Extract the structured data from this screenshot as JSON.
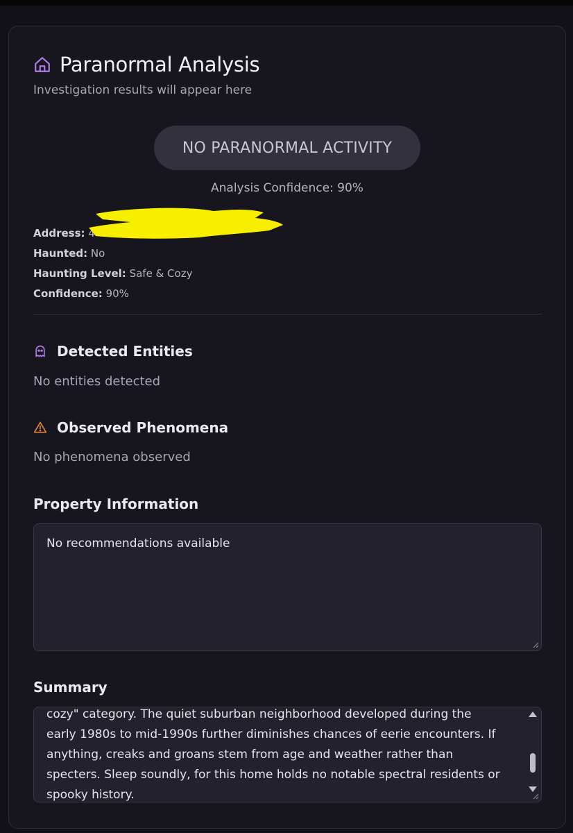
{
  "panel": {
    "title": "Paranormal Analysis",
    "subtitle": "Investigation results will appear here",
    "status_badge": "NO PARANORMAL ACTIVITY",
    "analysis_confidence": "Analysis Confidence: 90%"
  },
  "facts": {
    "address_label": "Address:",
    "address_value": "4",
    "haunted_label": "Haunted:",
    "haunted_value": "No",
    "level_label": "Haunting Level:",
    "level_value": "Safe & Cozy",
    "confidence_label": "Confidence:",
    "confidence_value": "90%"
  },
  "entities": {
    "heading": "Detected Entities",
    "text": "No entities detected",
    "icon": "ghost-icon"
  },
  "phenomena": {
    "heading": "Observed Phenomena",
    "text": "No phenomena observed",
    "icon": "warning-icon"
  },
  "property": {
    "heading": "Property Information",
    "value": "No recommendations available"
  },
  "summary": {
    "heading": "Summary",
    "partial_top_line": "cozy\" category. The quiet suburban neighborhood developed during the",
    "text": "early 1980s to mid-1990s further diminishes chances of eerie encounters. If anything, creaks and groans stem from age and weather rather than specters. Sleep soundly, for this home holds no notable spectral residents or spooky history."
  },
  "colors": {
    "accent_purple": "#b07ce8",
    "warning_orange": "#e0873f",
    "redaction_yellow": "#f7ee00"
  }
}
